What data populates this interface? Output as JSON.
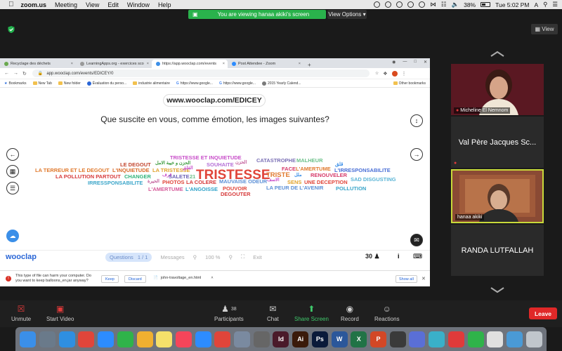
{
  "menubar": {
    "app_name": "zoom.us",
    "items": [
      "Meeting",
      "View",
      "Edit",
      "Window",
      "Help"
    ],
    "battery": "38%",
    "clock": "Tue 5:02 PM",
    "input_source": "A"
  },
  "share_banner": {
    "text": "You are viewing hanaa akiki's screen",
    "view_options": "View Options ▾"
  },
  "view_button": "▦ View",
  "browser": {
    "tabs": [
      {
        "label": "Recyclage des déchets",
        "color": "#6aa84f"
      },
      {
        "label": "LearningApps.org - exercices sco",
        "color": "#999999"
      },
      {
        "label": "https://app.wooclap.com/events",
        "color": "#3b8fe8"
      },
      {
        "label": "Post Attendee - Zoom",
        "color": "#2d8cff"
      }
    ],
    "new_tab": "+",
    "url": "app.wooclap.com/events/EDICEY/0",
    "bookmarks": [
      "Bookmarks",
      "New Tab",
      "New folder",
      "Évaluation du perso...",
      "industrie alimentaire",
      "https://www.google...",
      "https://www.google...",
      "2015 Yearly Calend...",
      "Other bookmarks"
    ]
  },
  "wooclap": {
    "event_url": "www.wooclap.com/EDICEY",
    "question": "Que suscite en vous, comme émotion, les images suivantes?",
    "logo": "wooclap",
    "footer": {
      "questions_label": "Questions",
      "questions_counter": "1 / 1",
      "messages_label": "Messages",
      "zoom_level": "100 %",
      "exit_label": "Exit",
      "participants": "30"
    },
    "word_cloud": [
      {
        "text": "TRISTESSE",
        "color": "#e0453a"
      },
      {
        "text": "TRISTESSE ET INQUIETUDE",
        "color": "#c84ec9"
      },
      {
        "text": "CATASTROPHE",
        "color": "#7a6fb5"
      },
      {
        "text": "MALHEUR",
        "color": "#6cc18a"
      },
      {
        "text": "LE DEGOUT",
        "color": "#c2452e"
      },
      {
        "text": "الحزن و خيبة الامل",
        "color": "#3b9a3b"
      },
      {
        "text": "SOUHAITE",
        "color": "#b46fd6"
      },
      {
        "text": "الحزن",
        "color": "#c25b99"
      },
      {
        "text": "قلق",
        "color": "#3b8fe8"
      },
      {
        "text": "LA TERREUR ET LE DEGOUT",
        "color": "#e07a2e"
      },
      {
        "text": "L'INQUIETUDE",
        "color": "#d96a2a"
      },
      {
        "text": "LA TRISTESSE",
        "color": "#e0a32e"
      },
      {
        "text": "القلق",
        "color": "#c84ec9"
      },
      {
        "text": "FACE",
        "color": "#d63a6a"
      },
      {
        "text": "L'AMERTUME",
        "color": "#e07a2e"
      },
      {
        "text": "L'IRRESPONSABILITE",
        "color": "#4a6fd6"
      },
      {
        "text": "LA POLLUTION PARTOUT",
        "color": "#d63a3a"
      },
      {
        "text": "CHANGER",
        "color": "#2fb37a"
      },
      {
        "text": "قرف",
        "color": "#c84ec9"
      },
      {
        "text": "SALETE",
        "color": "#6a5fb5"
      },
      {
        "text": "21",
        "color": "#6cc18a"
      },
      {
        "text": "TRISTE",
        "color": "#e07a2e"
      },
      {
        "text": "ملل",
        "color": "#3b8fe8"
      },
      {
        "text": "RENOUVELER",
        "color": "#d63a6a"
      },
      {
        "text": "SAD DISGUSTING",
        "color": "#5bb5d6"
      },
      {
        "text": "IRRESSPONSABILITE",
        "color": "#3aa5c9"
      },
      {
        "text": "الحيرة",
        "color": "#c25b99"
      },
      {
        "text": "PHOTOS",
        "color": "#e0453a"
      },
      {
        "text": "LA COLERE",
        "color": "#d63a3a"
      },
      {
        "text": "MAUVAISE ODEUR",
        "color": "#5b8fd6"
      },
      {
        "text": "الاسف",
        "color": "#c84ec9"
      },
      {
        "text": "SENS",
        "color": "#e0a32e"
      },
      {
        "text": "UNE DECEPTION",
        "color": "#e0453a"
      },
      {
        "text": "L'AMERTUME",
        "color": "#d65b9a"
      },
      {
        "text": "L'ANGOISSE",
        "color": "#2fa3c9"
      },
      {
        "text": "POUVOIR",
        "color": "#e0453a"
      },
      {
        "text": "LA PEUR DE L'AVENIR",
        "color": "#5b8fd6"
      },
      {
        "text": "POLLUTION",
        "color": "#3aa5c9"
      },
      {
        "text": "DEGOUTER",
        "color": "#d63a3a"
      }
    ]
  },
  "download_bar": {
    "message": "This type of file can harm your computer. Do you want to keep balloons_en.jar anyway?",
    "keep": "Keep",
    "discard": "Discard",
    "file": "john-travoltage_en.html",
    "show_all": "Show all"
  },
  "participants_panel": {
    "tiles": [
      {
        "name": "Micheline El Nemnom",
        "type": "video"
      },
      {
        "name": "Val Père Jacques Sc...",
        "type": "name"
      },
      {
        "name": "hanaa akiki",
        "type": "video",
        "active_speaker": true
      },
      {
        "name": "RANDA LUTFALLAH",
        "type": "name"
      }
    ]
  },
  "toolbar": {
    "unmute": "Unmute",
    "start_video": "Start Video",
    "participants": "Participants",
    "participants_count": "38",
    "chat": "Chat",
    "share_screen": "Share Screen",
    "record": "Record",
    "reactions": "Reactions",
    "leave": "Leave"
  },
  "dock": {
    "apps": [
      {
        "name": "Finder",
        "color": "#3b8fe8",
        "glyph": ""
      },
      {
        "name": "Launchpad",
        "color": "#6a7a8a",
        "glyph": ""
      },
      {
        "name": "Safari",
        "color": "#2f8fe0",
        "glyph": ""
      },
      {
        "name": "Chrome",
        "color": "#e0453a",
        "glyph": ""
      },
      {
        "name": "Zoom",
        "color": "#2d8cff",
        "glyph": ""
      },
      {
        "name": "FaceTime",
        "color": "#2fb34a",
        "glyph": ""
      },
      {
        "name": "Photos",
        "color": "#f0b030",
        "glyph": ""
      },
      {
        "name": "Notes",
        "color": "#f5e06a",
        "glyph": ""
      },
      {
        "name": "Music",
        "color": "#f5455a",
        "glyph": ""
      },
      {
        "name": "App Store",
        "color": "#2d8cff",
        "glyph": ""
      },
      {
        "name": "AnyDesk",
        "color": "#e0453a",
        "glyph": ""
      },
      {
        "name": "Preview",
        "color": "#7a8aa0",
        "glyph": ""
      },
      {
        "name": "Settings",
        "color": "#666666",
        "glyph": ""
      },
      {
        "name": "InDesign",
        "color": "#4a1a2a",
        "glyph": "Id"
      },
      {
        "name": "Illustrator",
        "color": "#3a1a0a",
        "glyph": "Ai"
      },
      {
        "name": "Photoshop",
        "color": "#0a1a3a",
        "glyph": "Ps"
      },
      {
        "name": "Word",
        "color": "#2b579a",
        "glyph": "W"
      },
      {
        "name": "Excel",
        "color": "#217346",
        "glyph": "X"
      },
      {
        "name": "PowerPoint",
        "color": "#d24726",
        "glyph": "P"
      },
      {
        "name": "Lifeline",
        "color": "#3a3a3a",
        "glyph": ""
      },
      {
        "name": "Teams",
        "color": "#5a6fd6",
        "glyph": ""
      },
      {
        "name": "Accessibility",
        "color": "#3ab0c9",
        "glyph": ""
      },
      {
        "name": "Creative Cloud",
        "color": "#e03a3a",
        "glyph": ""
      },
      {
        "name": "Messages",
        "color": "#2fb34a",
        "glyph": ""
      },
      {
        "name": "Documents",
        "color": "#e0e0e0",
        "glyph": ""
      },
      {
        "name": "Downloads",
        "color": "#4a9ad6",
        "glyph": ""
      },
      {
        "name": "Trash",
        "color": "#c0c6cc",
        "glyph": ""
      }
    ]
  }
}
